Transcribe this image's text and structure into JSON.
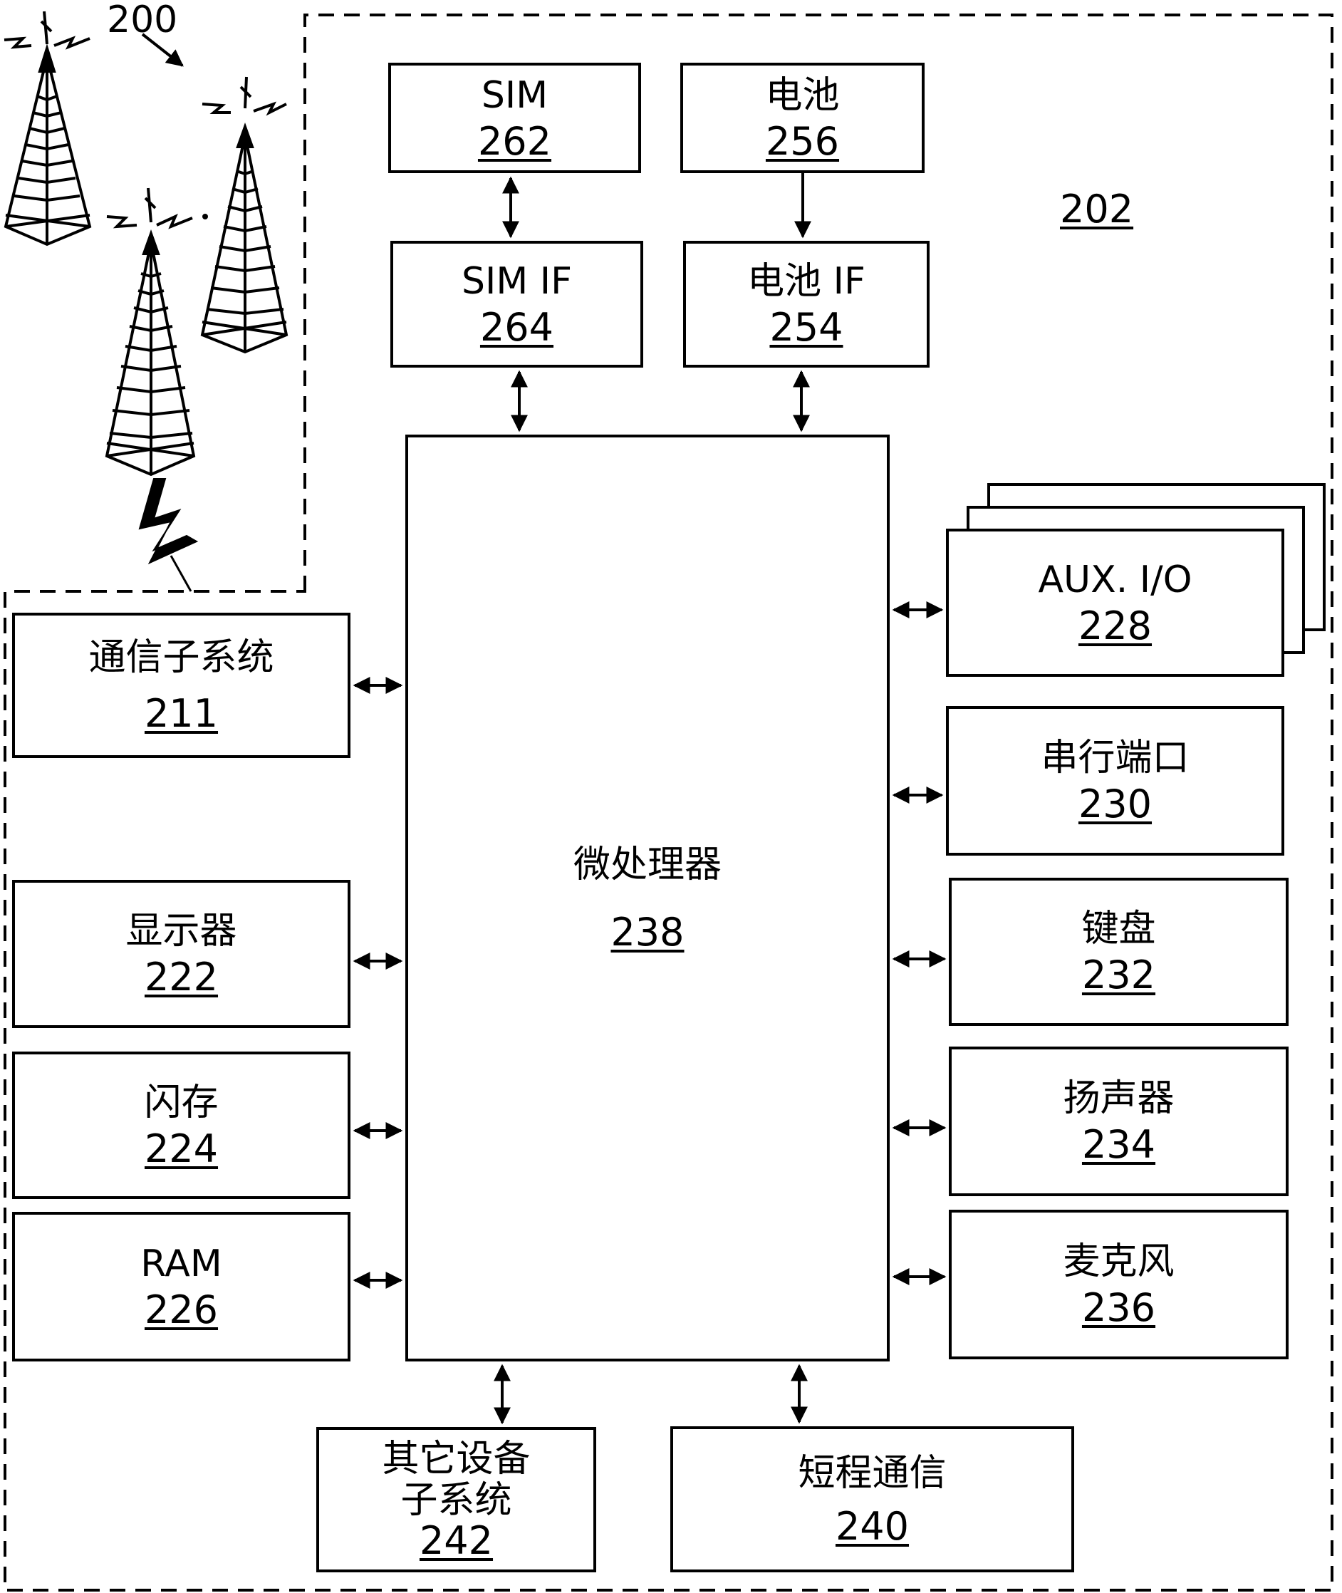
{
  "figure": {
    "system_label": "200",
    "device_label": "202"
  },
  "blocks": {
    "sim": {
      "name": "SIM",
      "ref": "262"
    },
    "battery": {
      "name": "电池",
      "ref": "256"
    },
    "sim_if": {
      "name": "SIM IF",
      "ref": "264"
    },
    "battery_if": {
      "name": "电池 IF",
      "ref": "254"
    },
    "microprocessor": {
      "name": "微处理器",
      "ref": "238"
    },
    "comm_subsystem": {
      "name": "通信子系统",
      "ref": "211"
    },
    "display": {
      "name": "显示器",
      "ref": "222"
    },
    "flash": {
      "name": "闪存",
      "ref": "224"
    },
    "ram": {
      "name": "RAM",
      "ref": "226"
    },
    "aux_io": {
      "name": "AUX. I/O",
      "ref": "228"
    },
    "serial_port": {
      "name": "串行端口",
      "ref": "230"
    },
    "keyboard": {
      "name": "键盘",
      "ref": "232"
    },
    "speaker": {
      "name": "扬声器",
      "ref": "234"
    },
    "microphone": {
      "name": "麦克风",
      "ref": "236"
    },
    "other_devices": {
      "name_line1": "其它设备",
      "name_line2": "子系统",
      "ref": "242"
    },
    "short_range": {
      "name": "短程通信",
      "ref": "240"
    }
  },
  "icons": [
    "cell-tower-icon",
    "cell-tower-icon",
    "cell-tower-icon",
    "lightning-bolt-icon"
  ]
}
